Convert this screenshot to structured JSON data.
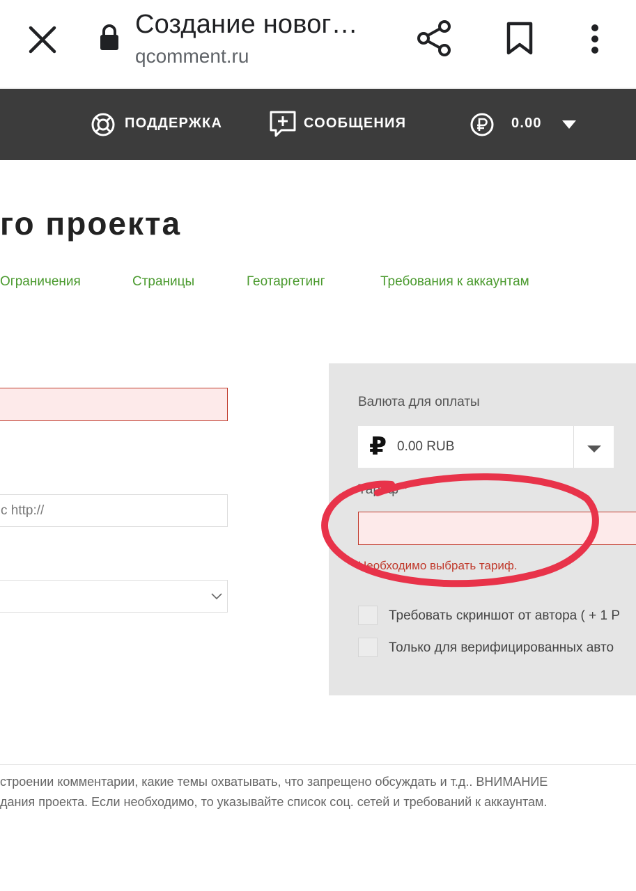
{
  "browser": {
    "title": "Создание новог…",
    "url": "qcomment.ru"
  },
  "nav": {
    "support_label": "ПОДДЕРЖКА",
    "messages_label": "СООБЩЕНИЯ",
    "balance_label": "0.00"
  },
  "page": {
    "title": "го проекта",
    "tabs": [
      "Ограничения",
      "Страницы",
      "Геотаргетинг",
      "Требования к аккаунтам"
    ]
  },
  "form": {
    "url_placeholder": "с http://"
  },
  "panel": {
    "currency_label": "Валюта для оплаты",
    "currency_symbol": "₽",
    "currency_value": "0.00 RUB",
    "tariff_label": "Тариф",
    "required_mark": "*",
    "tariff_error": "Необходимо выбрать тариф.",
    "checkbox_screenshot": "Требовать скриншот от автора ( + 1 Р",
    "checkbox_verified": "Только для верифицированных авто"
  },
  "footer": {
    "line1": "строении комментарии, какие темы охватывать, что запрещено обсуждать и т.д.. ВНИМАНИЕ",
    "line2": "дания проекта. Если необходимо, то указывайте список соц. сетей и требований к аккаунтам."
  },
  "colors": {
    "header_bg": "#3c3c3c",
    "tab_green": "#4a9a2e",
    "error_red": "#c0392b",
    "annotation": "#e8334a"
  }
}
